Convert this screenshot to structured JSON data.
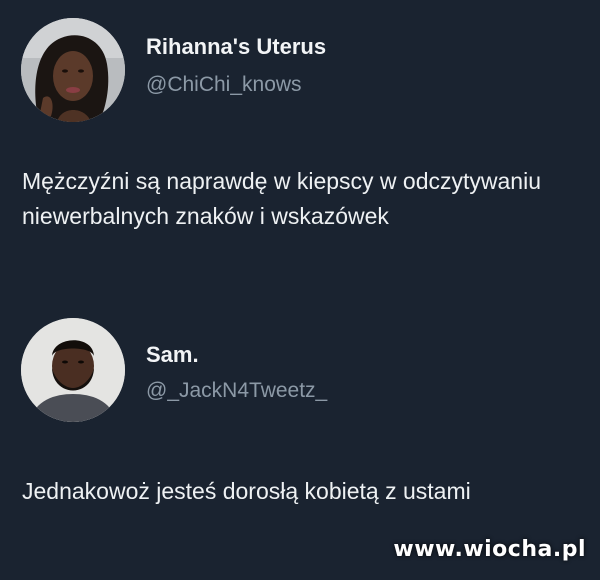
{
  "tweets": [
    {
      "display_name": "Rihanna's Uterus",
      "handle": "@ChiChi_knows",
      "text": "Mężczyźni są naprawdę w kiepscy w odczytywaniu niewerbalnych znaków i wskazówek"
    },
    {
      "display_name": "Sam.",
      "handle": "@_JackN4Tweetz_",
      "text": "Jednakowoż jesteś dorosłą kobietą z ustami"
    }
  ],
  "watermark": "www.wiocha.pl",
  "colors": {
    "background": "#1a2330",
    "primary_text": "#eef1f3",
    "secondary_text": "#8c99a6"
  }
}
